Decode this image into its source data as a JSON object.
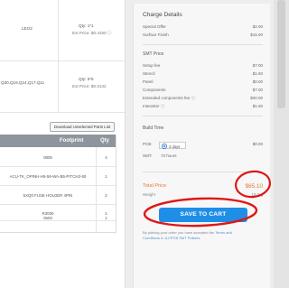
{
  "left_panel": {
    "grid": [
      {
        "part": "LEO2",
        "qty": "Qty: 1*1",
        "price": "Ext Price: $0.4190"
      },
      {
        "part": "Q30,Q18,Q14,Q17,Q11",
        "qty": "Qty: 5*5",
        "price": "Ext Price: $0.5132"
      }
    ],
    "download_button": "Download Unselected Parts List",
    "table": {
      "headers": {
        "footprint": "Footprint",
        "qty": "Qty"
      },
      "rows": [
        {
          "footprint": "0805",
          "qty": "4"
        },
        {
          "footprint": "ACU-TK_OPINH-H5-59-WA-B5-PITCH2-50",
          "qty": "1"
        },
        {
          "footprint": "5XQ0 FUSE HOLDER 4PIN",
          "qty": "2"
        },
        {
          "footprint": "R3000",
          "qty": "1"
        },
        {
          "footprint": "0603",
          "qty": "1"
        }
      ]
    }
  },
  "charge": {
    "title": "Charge Details",
    "top_items": [
      {
        "label": "Special Offer",
        "value": "$2.00"
      },
      {
        "label": "Surface Finish",
        "value": "$15.00"
      }
    ],
    "smt_section": "SMT Price",
    "smt_items": [
      {
        "label": "Setup fee",
        "value": "$7.00"
      },
      {
        "label": "Stencil",
        "value": "$1.50"
      },
      {
        "label": "Panel",
        "value": "$0.00"
      },
      {
        "label": "Components",
        "value": "$7.00"
      },
      {
        "label": "Extended components fee",
        "value": "$30.00"
      },
      {
        "label": "Intensiter",
        "value": "$1.50"
      }
    ],
    "build_section": "Build Time",
    "pcb_label": "PCB:",
    "pcb_option": "3 days",
    "pcb_value": "$0.00",
    "smt_label": "SMT:",
    "smt_time": "72 hours",
    "total_label": "Total Price",
    "total_value": "$65.10",
    "weight_label": "Weight",
    "weight_value": "19.3 g",
    "save_button": "SAVE TO CART",
    "terms_text": "By placing your order you have accepted the ",
    "terms_link1": "Terms and",
    "terms_link2": "Conditions & JLCPCB SMT Policies"
  },
  "colors": {
    "accent": "#1f8ee6",
    "total": "#e8772e",
    "annotation": "#e01616"
  }
}
